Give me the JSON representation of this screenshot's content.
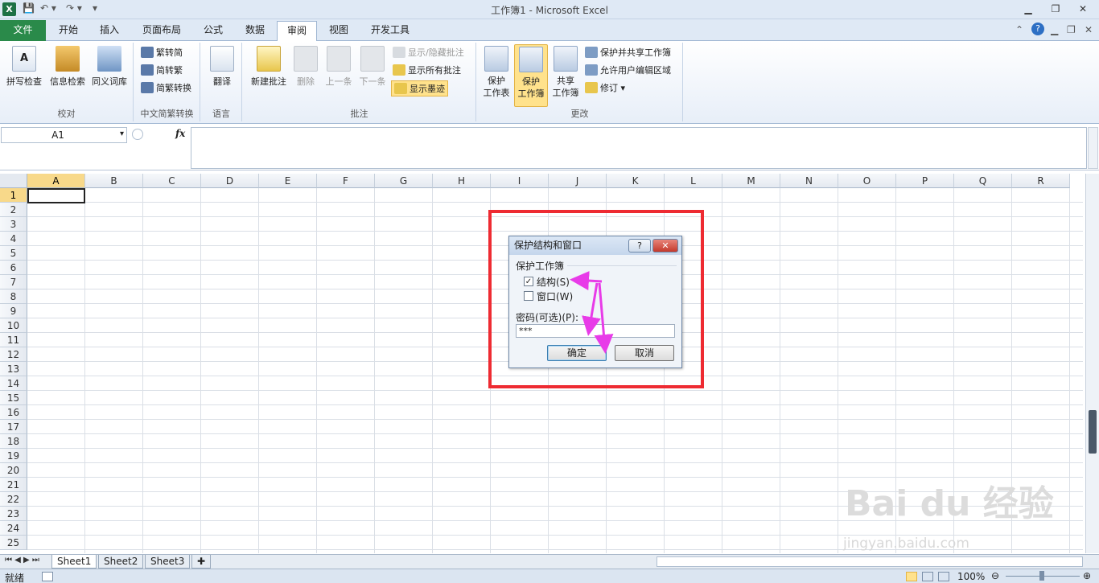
{
  "titlebar": {
    "title": "工作簿1 - Microsoft Excel"
  },
  "tabs": [
    {
      "label": "文件"
    },
    {
      "label": "开始"
    },
    {
      "label": "插入"
    },
    {
      "label": "页面布局"
    },
    {
      "label": "公式"
    },
    {
      "label": "数据"
    },
    {
      "label": "审阅"
    },
    {
      "label": "视图"
    },
    {
      "label": "开发工具"
    }
  ],
  "ribbon": {
    "proofing": {
      "label": "校对",
      "spell": "拼写检查",
      "research": "信息检索",
      "thesaurus": "同义词库"
    },
    "chinese": {
      "label": "中文简繁转换",
      "to_simp": "繁转简",
      "to_trad": "简转繁",
      "convert": "简繁转换"
    },
    "language": {
      "label": "语言",
      "translate": "翻译"
    },
    "comments": {
      "label": "批注",
      "new": "新建批注",
      "delete": "删除",
      "prev": "上一条",
      "next": "下一条",
      "show_hide": "显示/隐藏批注",
      "show_all": "显示所有批注",
      "show_ink": "显示墨迹"
    },
    "changes": {
      "label": "更改",
      "protect_sheet": "保护工作表",
      "protect_sheet_l1": "保护",
      "protect_sheet_l2": "工作表",
      "protect_wb_l1": "保护",
      "protect_wb_l2": "工作簿",
      "share_l1": "共享",
      "share_l2": "工作簿",
      "protect_share": "保护并共享工作簿",
      "allow_edit": "允许用户编辑区域",
      "track": "修订"
    }
  },
  "formula": {
    "namebox": "A1",
    "fx": "fx",
    "value": ""
  },
  "columns": [
    "A",
    "B",
    "C",
    "D",
    "E",
    "F",
    "G",
    "H",
    "I",
    "J",
    "K",
    "L",
    "M",
    "N",
    "O",
    "P",
    "Q",
    "R"
  ],
  "rows": [
    "1",
    "2",
    "3",
    "4",
    "5",
    "6",
    "7",
    "8",
    "9",
    "10",
    "11",
    "12",
    "13",
    "14",
    "15",
    "16",
    "17",
    "18",
    "19",
    "20",
    "21",
    "22",
    "23",
    "24",
    "25"
  ],
  "sheets": [
    "Sheet1",
    "Sheet2",
    "Sheet3"
  ],
  "status": {
    "ready": "就绪",
    "zoom": "100%"
  },
  "dialog": {
    "title": "保护结构和窗口",
    "help": "?",
    "close": "✕",
    "group": "保护工作簿",
    "structure": "结构(S)",
    "window": "窗口(W)",
    "password_label": "密码(可选)(P):",
    "password_value": "***",
    "ok": "确定",
    "cancel": "取消"
  },
  "watermark": {
    "brand": "Bai du 经验",
    "url": "jingyan.baidu.com"
  },
  "colors": {
    "file_tab": "#2a8a4a",
    "highlight": "#ffe28c",
    "red_box": "#ee2b32",
    "arrow": "#e83be8"
  }
}
